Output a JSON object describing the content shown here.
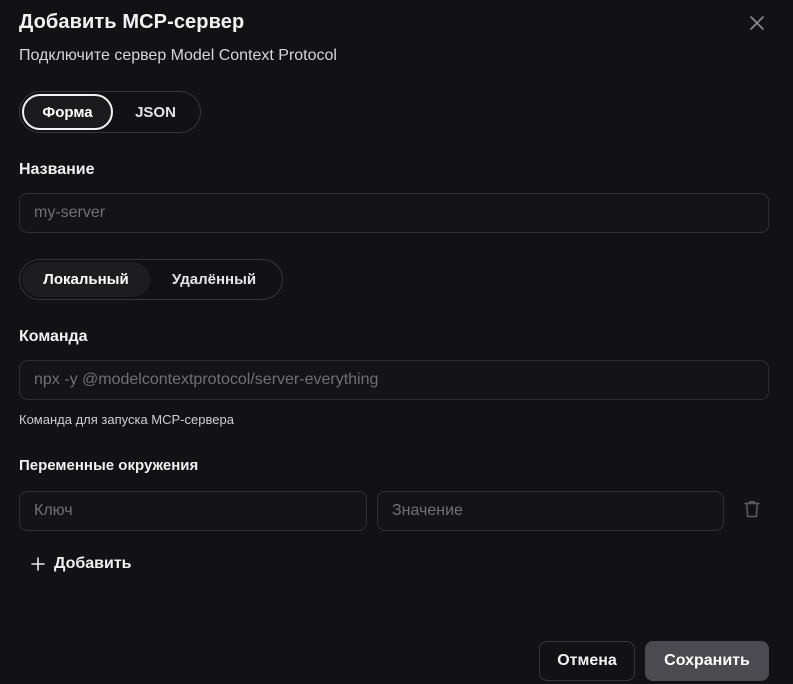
{
  "dialog": {
    "title": "Добавить MCP-сервер",
    "subtitle": "Подключите сервер Model Context Protocol",
    "close_icon": "close-icon"
  },
  "mode_tabs": {
    "form": "Форма",
    "json": "JSON",
    "selected": "Форма"
  },
  "name_field": {
    "label": "Название",
    "placeholder": "my-server",
    "value": ""
  },
  "server_type": {
    "local": "Локальный",
    "remote": "Удалённый",
    "selected": "Локальный"
  },
  "command_field": {
    "label": "Команда",
    "placeholder": "npx -y @modelcontextprotocol/server-everything",
    "value": "",
    "hint": "Команда для запуска MCP-сервера"
  },
  "env": {
    "label": "Переменные окружения",
    "key_placeholder": "Ключ",
    "value_placeholder": "Значение",
    "delete_icon": "trash-icon",
    "add_label": "Добавить",
    "add_icon": "plus-icon"
  },
  "footer": {
    "cancel_label": "Отмена",
    "save_label": "Сохранить"
  },
  "colors": {
    "background": "#121214",
    "border": "#2e2e33",
    "save_button": "#4a4a50"
  }
}
